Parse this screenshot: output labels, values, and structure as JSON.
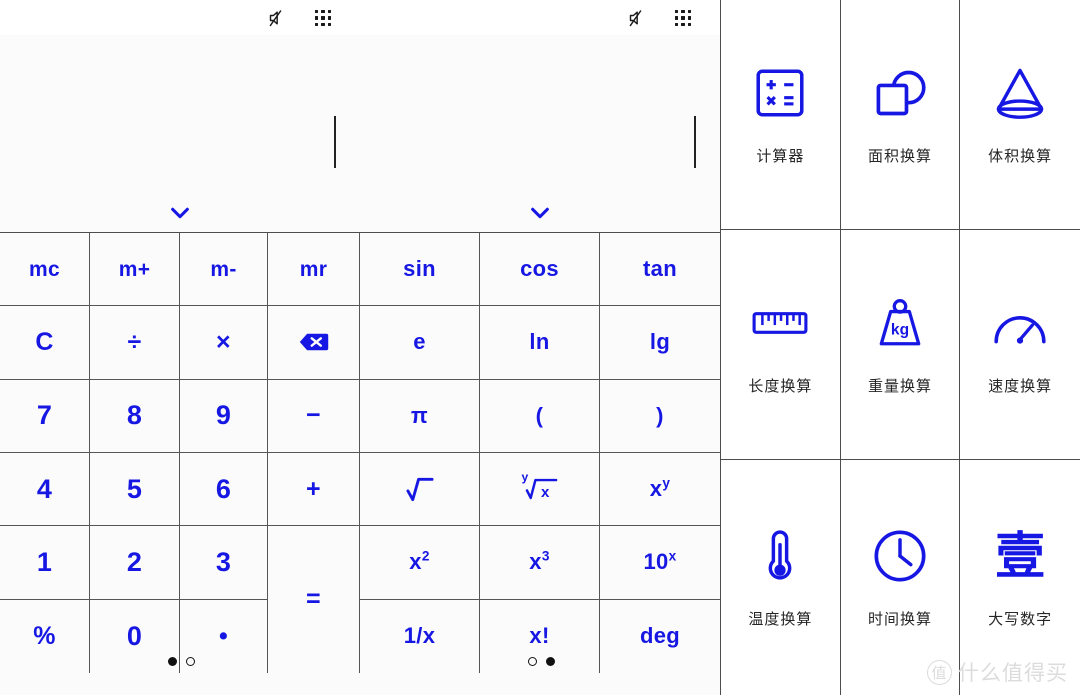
{
  "status_bar": {
    "panes": [
      {
        "mute_icon": "mute-icon",
        "apps_icon": "apps-grid-icon"
      },
      {
        "mute_icon": "mute-icon",
        "apps_icon": "apps-grid-icon"
      }
    ]
  },
  "display": {
    "pane_a": {
      "value": "",
      "caret": true,
      "expand_icon": "chevron-down-icon"
    },
    "pane_b": {
      "value": "",
      "caret": true,
      "expand_icon": "chevron-down-icon"
    }
  },
  "keypad": {
    "basic": {
      "keys": [
        {
          "label": "mc",
          "name": "key-memory-clear",
          "kind": "memo"
        },
        {
          "label": "m+",
          "name": "key-memory-add",
          "kind": "memo"
        },
        {
          "label": "m-",
          "name": "key-memory-sub",
          "kind": "memo"
        },
        {
          "label": "mr",
          "name": "key-memory-recall",
          "kind": "memo"
        },
        {
          "label": "C",
          "name": "key-clear",
          "kind": "op"
        },
        {
          "label": "÷",
          "name": "key-divide",
          "kind": "op"
        },
        {
          "label": "×",
          "name": "key-multiply",
          "kind": "op"
        },
        {
          "label": "",
          "name": "key-backspace",
          "kind": "icon-backspace"
        },
        {
          "label": "7",
          "name": "key-7",
          "kind": "digit"
        },
        {
          "label": "8",
          "name": "key-8",
          "kind": "digit"
        },
        {
          "label": "9",
          "name": "key-9",
          "kind": "digit"
        },
        {
          "label": "−",
          "name": "key-minus",
          "kind": "op"
        },
        {
          "label": "4",
          "name": "key-4",
          "kind": "digit"
        },
        {
          "label": "5",
          "name": "key-5",
          "kind": "digit"
        },
        {
          "label": "6",
          "name": "key-6",
          "kind": "digit"
        },
        {
          "label": "+",
          "name": "key-plus",
          "kind": "op"
        },
        {
          "label": "1",
          "name": "key-1",
          "kind": "digit"
        },
        {
          "label": "2",
          "name": "key-2",
          "kind": "digit"
        },
        {
          "label": "3",
          "name": "key-3",
          "kind": "digit"
        },
        {
          "label": "=",
          "name": "key-equals",
          "kind": "equals"
        },
        {
          "label": "%",
          "name": "key-percent",
          "kind": "op"
        },
        {
          "label": "0",
          "name": "key-0",
          "kind": "digit"
        },
        {
          "label": "•",
          "name": "key-decimal-point",
          "kind": "op"
        }
      ]
    },
    "scientific": {
      "keys": [
        {
          "label": "sin",
          "name": "key-sin",
          "kind": "text"
        },
        {
          "label": "cos",
          "name": "key-cos",
          "kind": "text"
        },
        {
          "label": "tan",
          "name": "key-tan",
          "kind": "text"
        },
        {
          "label": "e",
          "name": "key-e",
          "kind": "text"
        },
        {
          "label": "ln",
          "name": "key-ln",
          "kind": "text"
        },
        {
          "label": "lg",
          "name": "key-lg",
          "kind": "text"
        },
        {
          "label": "π",
          "name": "key-pi",
          "kind": "text"
        },
        {
          "label": "(",
          "name": "key-paren-open",
          "kind": "text"
        },
        {
          "label": ")",
          "name": "key-paren-close",
          "kind": "text"
        },
        {
          "label": "√",
          "name": "key-square-root",
          "kind": "icon-sqrt"
        },
        {
          "label": "ʸ√x",
          "name": "key-nth-root",
          "kind": "nth-root",
          "index": "y",
          "radicand": "x"
        },
        {
          "label": "xʸ",
          "name": "key-x-power-y",
          "kind": "sup",
          "base": "x",
          "exp": "y"
        },
        {
          "label": "x²",
          "name": "key-x-squared",
          "kind": "sup",
          "base": "x",
          "exp": "2"
        },
        {
          "label": "x³",
          "name": "key-x-cubed",
          "kind": "sup",
          "base": "x",
          "exp": "3"
        },
        {
          "label": "10ˣ",
          "name": "key-ten-power-x",
          "kind": "sup",
          "base": "10",
          "exp": "x"
        },
        {
          "label": "1/x",
          "name": "key-reciprocal",
          "kind": "text"
        },
        {
          "label": "x!",
          "name": "key-factorial",
          "kind": "text"
        },
        {
          "label": "deg",
          "name": "key-degree-mode",
          "kind": "text"
        }
      ]
    }
  },
  "page_indicators": {
    "pane_a": {
      "count": 2,
      "active": 0
    },
    "pane_b": {
      "count": 2,
      "active": 1
    }
  },
  "converter": {
    "cells": [
      {
        "label": "计算器",
        "icon": "calculator-icon",
        "name": "converter-calculator"
      },
      {
        "label": "面积换算",
        "icon": "area-icon",
        "name": "converter-area"
      },
      {
        "label": "体积换算",
        "icon": "volume-cone-icon",
        "name": "converter-volume"
      },
      {
        "label": "长度换算",
        "icon": "ruler-icon",
        "name": "converter-length"
      },
      {
        "label": "重量换算",
        "icon": "weight-kg-icon",
        "name": "converter-weight"
      },
      {
        "label": "速度换算",
        "icon": "speedometer-icon",
        "name": "converter-speed"
      },
      {
        "label": "温度换算",
        "icon": "thermometer-icon",
        "name": "converter-temperature"
      },
      {
        "label": "时间换算",
        "icon": "clock-icon",
        "name": "converter-time"
      },
      {
        "label": "大写数字",
        "icon": "chinese-numeral-icon",
        "glyph": "壹",
        "name": "converter-chinese-numeral"
      }
    ]
  },
  "watermark": {
    "mark": "值",
    "text": "什么值得买"
  },
  "colors": {
    "accent_blue": "#1717e4",
    "keypad_bg": "#fbfbfb",
    "grid_line": "#555555",
    "label_text": "#262626",
    "watermark": "#dcdcdc"
  }
}
